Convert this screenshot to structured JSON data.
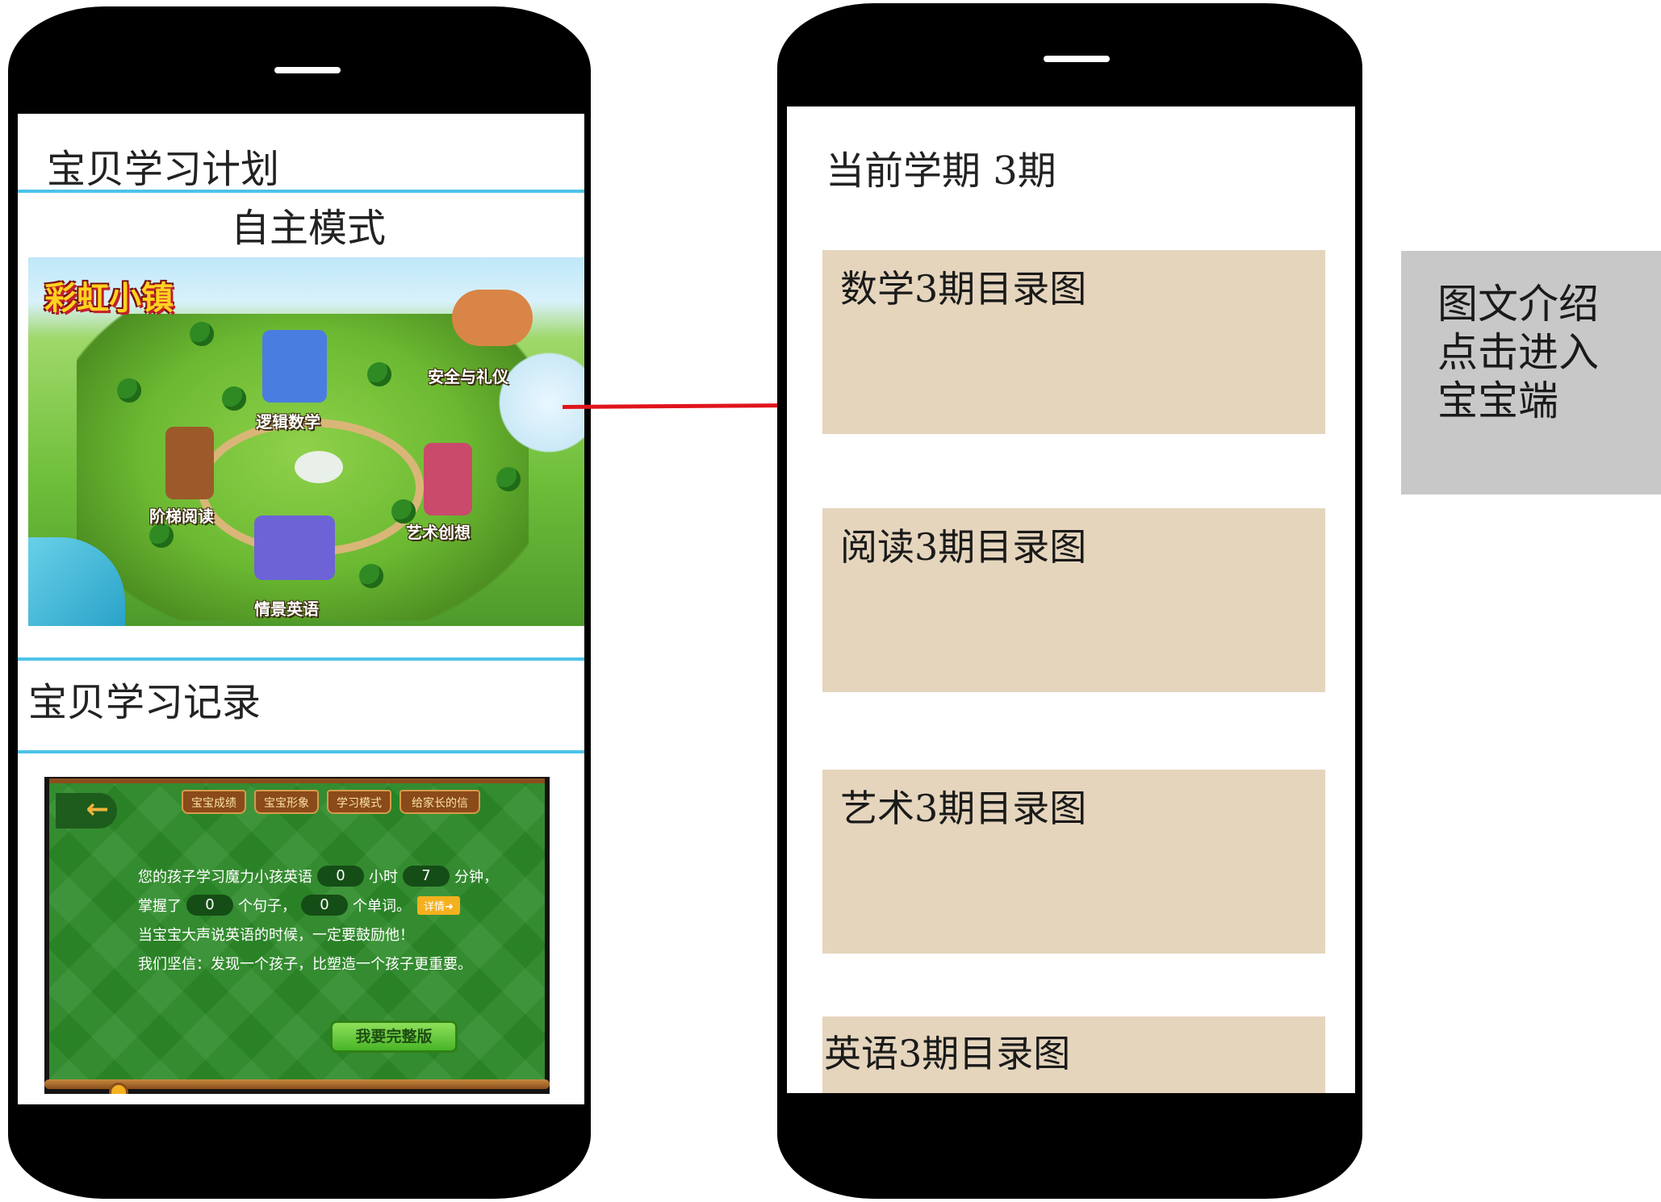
{
  "left_phone": {
    "header_title": "宝贝学习计划",
    "mode_title": "自主模式",
    "map": {
      "logo": "彩虹小镇",
      "labels": [
        "安全与礼仪",
        "逻辑数学",
        "阶梯阅读",
        "艺术创想",
        "情景英语"
      ]
    },
    "record_title": "宝贝学习记录",
    "record": {
      "back_icon": "arrow-left-icon",
      "tabs": [
        "宝宝成绩",
        "宝宝形象",
        "学习模式",
        "给家长的信"
      ],
      "line1": {
        "prefix": "您的孩子学习魔力小孩英语",
        "hours": "0",
        "hours_unit": "小时",
        "minutes": "7",
        "minutes_unit": "分钟，"
      },
      "line2": {
        "prefix": "掌握了",
        "sentences": "0",
        "sentences_unit": "个句子，",
        "words": "0",
        "words_unit": "个单词。",
        "detail": "详情"
      },
      "line3": "当宝宝大声说英语的时候，一定要鼓励他！",
      "line4": "我们坚信：发现一个孩子，比塑造一个孩子更重要。",
      "full_version_button": "我要完整版"
    }
  },
  "right_phone": {
    "current_term": "当前学期 3期",
    "catalogs": [
      {
        "label": "数学3期目录图"
      },
      {
        "label": "阅读3期目录图"
      },
      {
        "label": "艺术3期目录图"
      },
      {
        "label": "英语3期目录图"
      }
    ]
  },
  "note": {
    "lines": [
      "图文介绍",
      "点击进入",
      "宝宝端"
    ]
  },
  "colors": {
    "phone_frame": "#000000",
    "divider": "#4cc3ea",
    "catalog_bg": "#e5d5bd",
    "connector": "#e0141b",
    "note_bg": "#c8c8c8",
    "board_green": "#2e8c2a"
  }
}
